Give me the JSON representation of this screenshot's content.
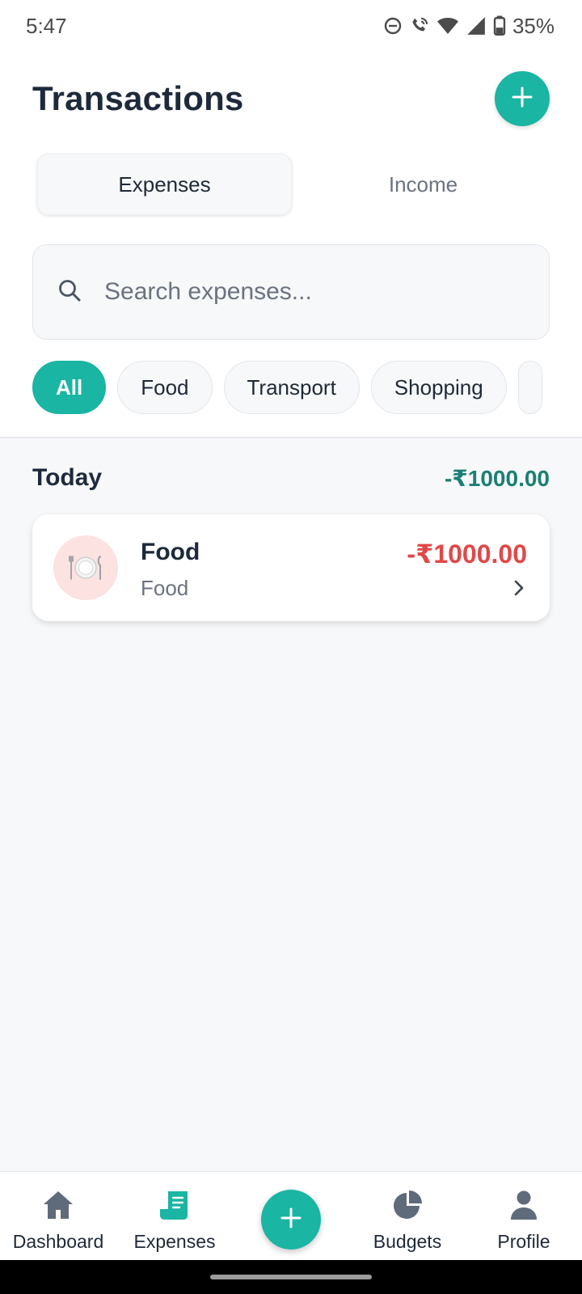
{
  "status_bar": {
    "time": "5:47",
    "battery": "35%",
    "icons": [
      "dnd-icon",
      "wifi-call-icon",
      "wifi-icon",
      "signal-icon",
      "battery-icon"
    ]
  },
  "header": {
    "title": "Transactions",
    "add_icon": "plus-icon"
  },
  "tabs": [
    {
      "label": "Expenses",
      "active": true
    },
    {
      "label": "Income",
      "active": false
    }
  ],
  "search": {
    "placeholder": "Search expenses...",
    "value": "",
    "icon": "search-icon"
  },
  "filters": [
    {
      "label": "All",
      "active": true
    },
    {
      "label": "Food",
      "active": false
    },
    {
      "label": "Transport",
      "active": false
    },
    {
      "label": "Shopping",
      "active": false
    }
  ],
  "groups": [
    {
      "title": "Today",
      "total": "-₹1000.00",
      "transactions": [
        {
          "title": "Food",
          "category": "Food",
          "amount": "-₹1000.00",
          "icon": "plate-cutlery-icon"
        }
      ]
    }
  ],
  "bottom_nav": {
    "items": [
      {
        "label": "Dashboard",
        "icon": "home-icon",
        "active": false
      },
      {
        "label": "Expenses",
        "icon": "receipt-icon",
        "active": true
      },
      {
        "label": "Budgets",
        "icon": "pie-chart-icon",
        "active": false
      },
      {
        "label": "Profile",
        "icon": "person-icon",
        "active": false
      }
    ],
    "center_icon": "plus-icon"
  },
  "colors": {
    "accent": "#1ab5a3",
    "group_total": "#1b7f74",
    "expense_amount": "#e04848",
    "title": "#1e2a3b",
    "muted": "#6b7280",
    "list_background": "#f7f8fa",
    "icon_background": "#fde2e2"
  }
}
